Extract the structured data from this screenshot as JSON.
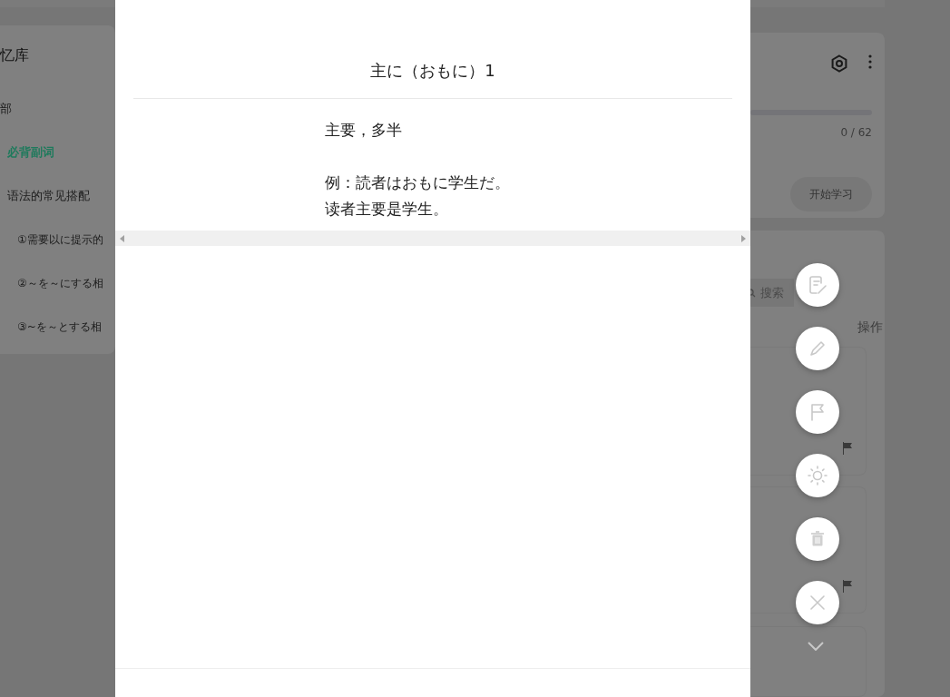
{
  "sidebar": {
    "title": "忆库",
    "items": [
      {
        "label": "部",
        "selected": false,
        "children": [
          {
            "label": "必背副词",
            "selected": true
          },
          {
            "label": "语法的常见搭配",
            "selected": false,
            "children": [
              {
                "label": "①需要以に提示的",
                "selected": false
              },
              {
                "label": "②～を～にする相",
                "selected": false
              },
              {
                "label": "③~を～とする相",
                "selected": false
              }
            ]
          }
        ]
      }
    ]
  },
  "modal": {
    "title": "主に（おもに）1",
    "meaning": "主要，多半",
    "example": [
      "例：読者はおもに学生だ。",
      "读者主要是学生。"
    ]
  },
  "deck": {
    "progress": {
      "level": 0,
      "count": "0 / 62"
    },
    "start_button": "开始学习"
  },
  "list": {
    "search": {
      "placeholder": "搜索"
    },
    "bulk_action": "操作",
    "cards": [
      {
        "flagged": true,
        "kind": "card"
      },
      {
        "flagged": true,
        "kind": "card"
      },
      {
        "flagged": false,
        "kind": "collapsed"
      }
    ]
  },
  "actions": [
    {
      "kind": "edit-note"
    },
    {
      "kind": "pencil"
    },
    {
      "kind": "flag"
    },
    {
      "kind": "sun"
    },
    {
      "kind": "trash"
    },
    {
      "kind": "close"
    }
  ]
}
